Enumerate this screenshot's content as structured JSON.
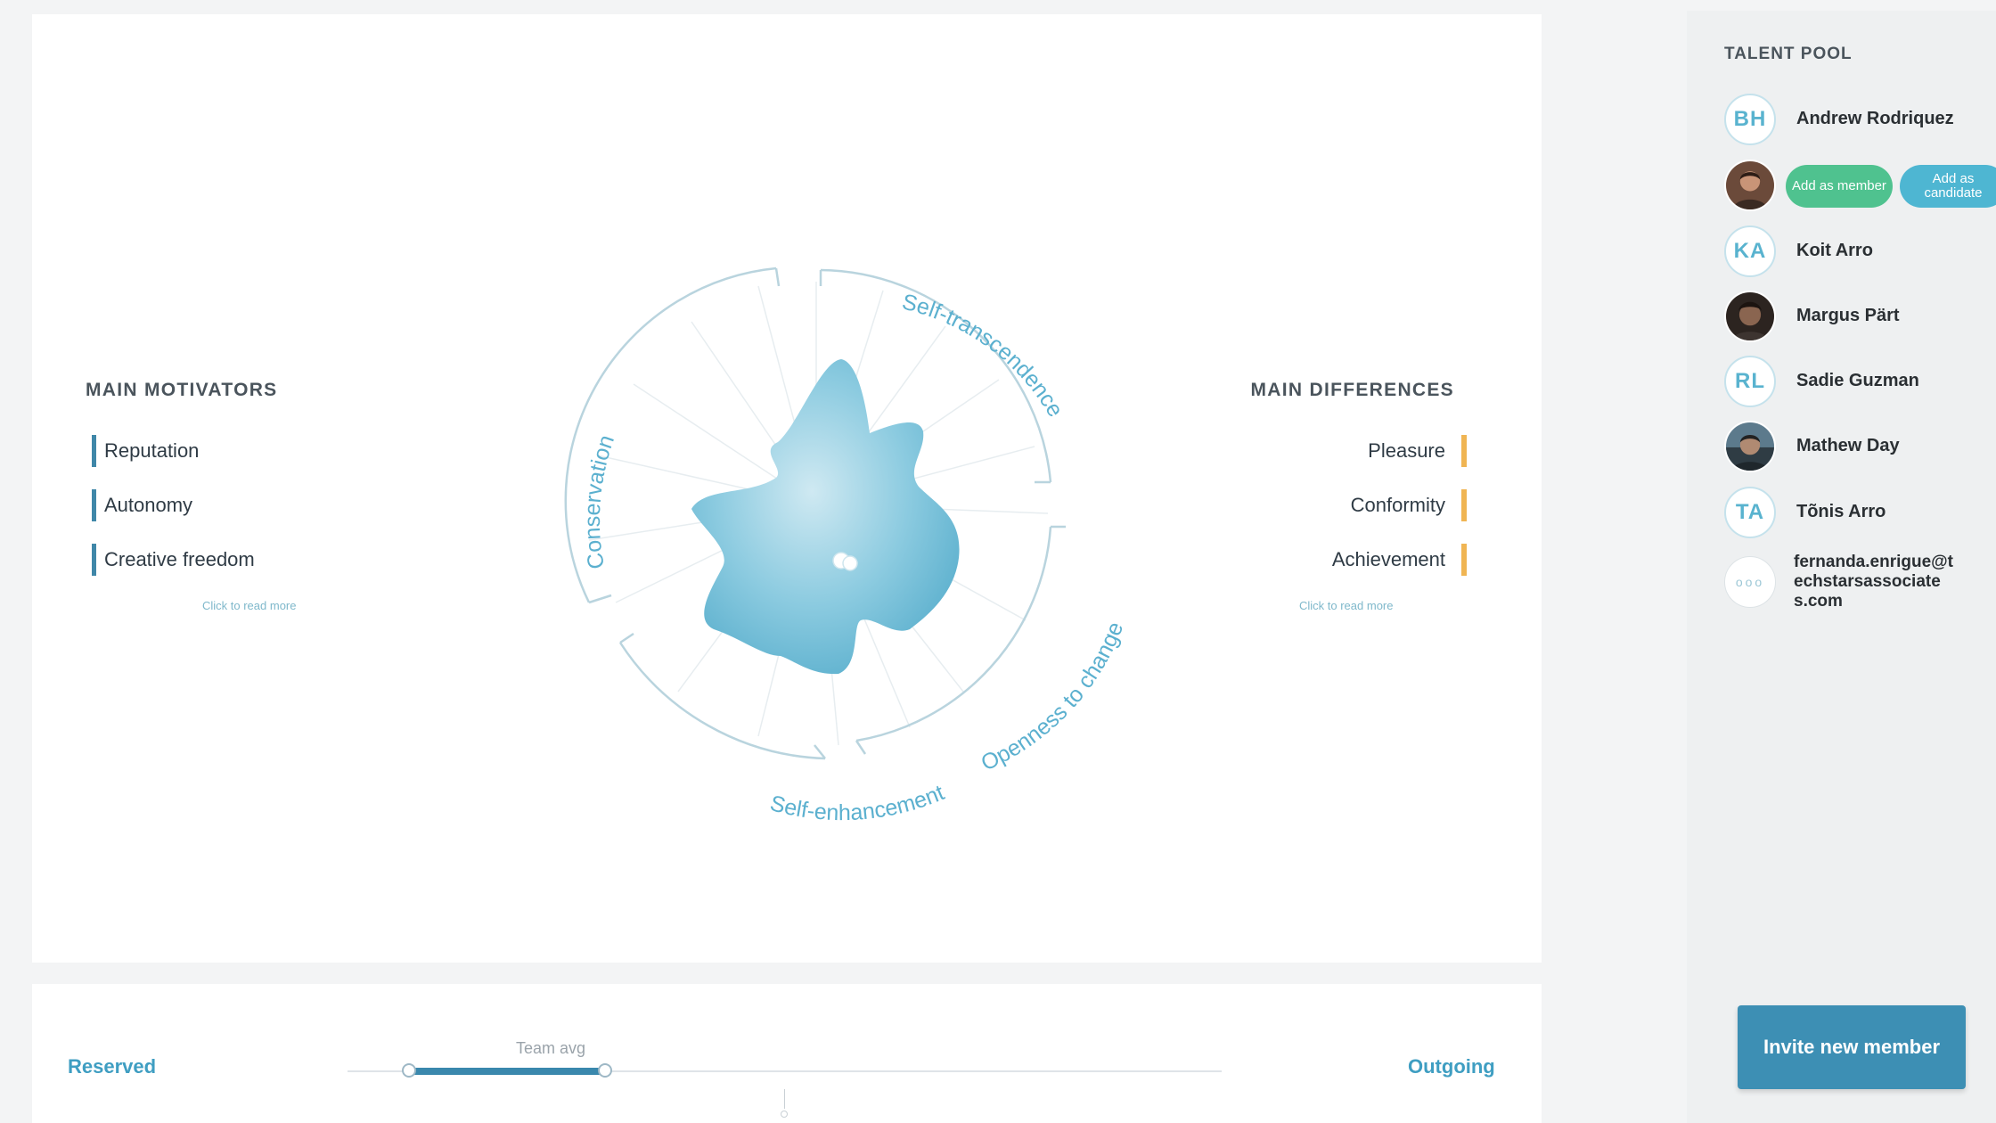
{
  "motivators": {
    "title": "MAIN MOTIVATORS",
    "items": [
      "Reputation",
      "Autonomy",
      "Creative freedom"
    ],
    "read_more": "Click to read more",
    "bar_color": "#3f87a8"
  },
  "differences": {
    "title": "MAIN DIFFERENCES",
    "items": [
      "Pleasure",
      "Conformity",
      "Achievement"
    ],
    "read_more": "Click to read more",
    "bar_color": "#f0b553"
  },
  "radar": {
    "segments": [
      "Self-transcendence",
      "Openness to change",
      "Self-enhancement",
      "Conservation"
    ],
    "accent": "#5bb0cf"
  },
  "slider": {
    "left_label": "Reserved",
    "right_label": "Outgoing",
    "team_avg_label": "Team avg",
    "range_start": 0.07,
    "range_end": 0.295,
    "team_avg": 0.33
  },
  "talent_pool": {
    "title": "TALENT POOL",
    "members": [
      {
        "type": "initials",
        "initials": "BH",
        "name": "Andrew Rodriquez"
      },
      {
        "type": "photo",
        "name": "",
        "actions": [
          "Add as member",
          "Add as candidate"
        ]
      },
      {
        "type": "initials",
        "initials": "KA",
        "name": "Koit Arro"
      },
      {
        "type": "photo",
        "name": "Margus Pärt"
      },
      {
        "type": "initials",
        "initials": "RL",
        "name": "Sadie Guzman"
      },
      {
        "type": "photo",
        "name": "Mathew  Day"
      },
      {
        "type": "initials",
        "initials": "TA",
        "name": "Tõnis Arro"
      },
      {
        "type": "pending",
        "initials": "ooo",
        "name": "fernanda.enrigue@techstarsassociates.com"
      }
    ],
    "invite_label": "Invite new member"
  }
}
